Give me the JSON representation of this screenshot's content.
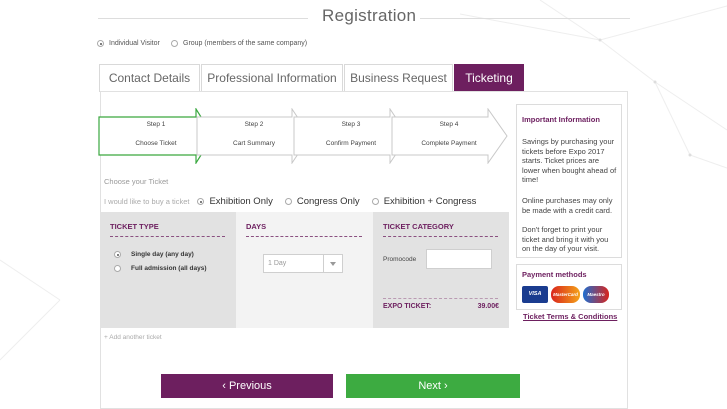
{
  "page": {
    "title": "Registration"
  },
  "visitor_type": {
    "options": [
      {
        "label": "Individual Visitor",
        "selected": true
      },
      {
        "label": "Group (members of the same company)",
        "selected": false
      }
    ]
  },
  "tabs": [
    {
      "label": "Contact Details",
      "active": false
    },
    {
      "label": "Professional Information",
      "active": false
    },
    {
      "label": "Business Request",
      "active": false
    },
    {
      "label": "Ticketing",
      "active": true
    }
  ],
  "steps": [
    {
      "step": "Step 1",
      "name": "Choose Ticket",
      "active": true
    },
    {
      "step": "Step 2",
      "name": "Cart Summary",
      "active": false
    },
    {
      "step": "Step 3",
      "name": "Confirm Payment",
      "active": false
    },
    {
      "step": "Step 4",
      "name": "Complete Payment",
      "active": false
    }
  ],
  "ticket_form": {
    "heading": "Choose your Ticket",
    "buy_label": "I would like to buy a ticket",
    "buy_options": [
      {
        "label": "Exhibition Only",
        "selected": true
      },
      {
        "label": "Congress Only",
        "selected": false
      },
      {
        "label": "Exhibition + Congress",
        "selected": false
      }
    ],
    "ticket_type": {
      "heading": "TICKET TYPE",
      "options": [
        {
          "label": "Single day (any day)",
          "selected": true
        },
        {
          "label": "Full admission (all days)",
          "selected": false
        }
      ]
    },
    "days": {
      "heading": "DAYS",
      "selected": "1 Day"
    },
    "category": {
      "heading": "TICKET CATEGORY",
      "promocode_label": "Promocode",
      "promocode_value": "",
      "expo_label": "EXPO TICKET:",
      "expo_price": "39.00€"
    },
    "add_another": "+ Add another ticket"
  },
  "nav": {
    "previous": "‹ Previous",
    "next": "Next ›"
  },
  "sidebar": {
    "info_title": "Important Information",
    "info_paragraphs": [
      "Savings by purchasing your tickets before Expo 2017 starts. Ticket prices are lower when bought ahead of time!",
      "Online purchases may only be made with a credit card.",
      "Don't forget to print your ticket and bring it with you on the day of your visit."
    ],
    "payment_title": "Payment methods",
    "cards": [
      "VISA",
      "MasterCard",
      "Maestro"
    ],
    "terms_link": "Ticket Terms & Conditions"
  },
  "colors": {
    "brand": "#6d1f5f",
    "next": "#3dab41",
    "step_active": "#3aa83f"
  }
}
